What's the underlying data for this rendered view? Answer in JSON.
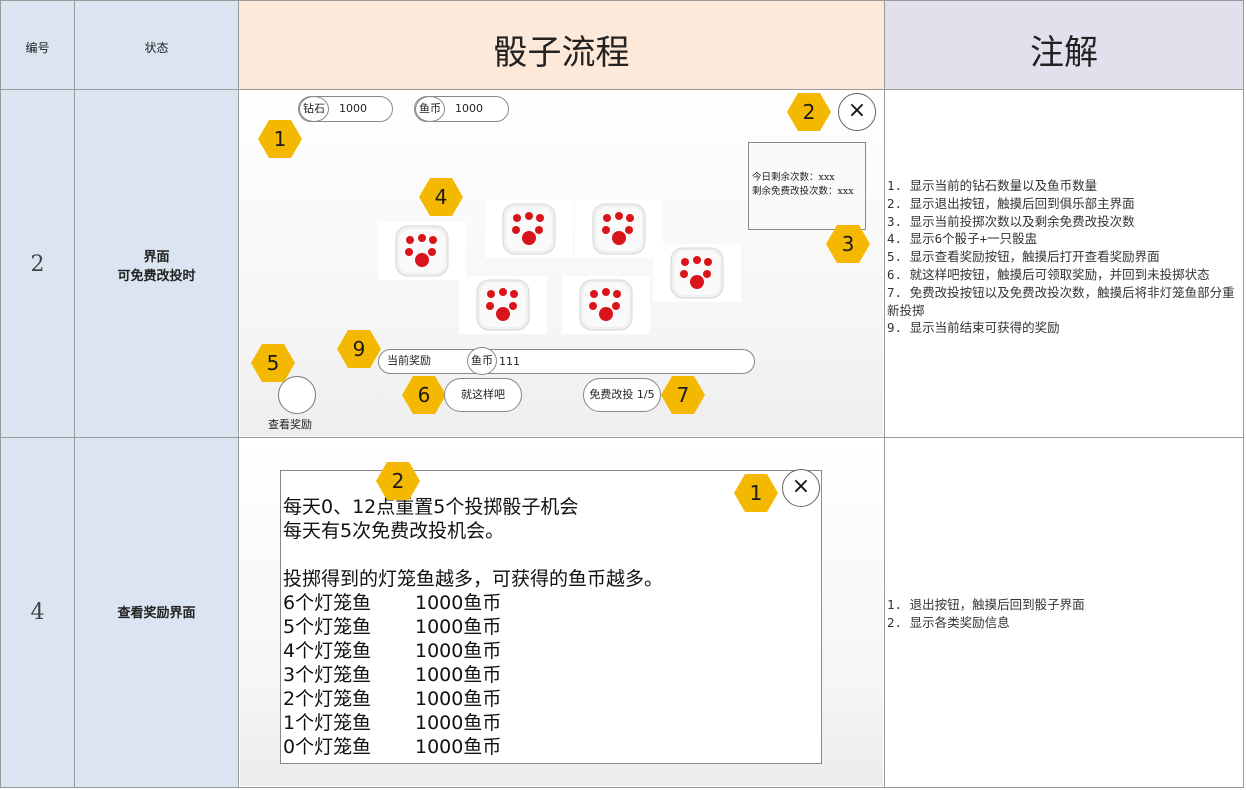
{
  "table": {
    "header": {
      "col_id": "编号",
      "col_state": "状态",
      "col_flow": "骰子流程",
      "col_notes": "注解"
    },
    "rows": [
      {
        "id": "2",
        "state_line1": "界面",
        "state_line2": "可免费改投时",
        "notes": [
          "1. 显示当前的钻石数量以及鱼币数量",
          "2. 显示退出按钮，触摸后回到俱乐部主界面",
          "3. 显示当前投掷次数以及剩余免费改投次数",
          "4. 显示6个骰子+一只骰盅",
          "5. 显示查看奖励按钮，触摸后打开查看奖励界面",
          "6. 就这样吧按钮，触摸后可领取奖励，并回到未投掷状态",
          "7. 免费改投按钮以及免费改投次数，触摸后将非灯笼鱼部分重新投掷",
          "9. 显示当前结束可获得的奖励"
        ]
      },
      {
        "id": "4",
        "state_line1": "查看奖励界面",
        "notes": [
          "1. 退出按钮，触摸后回到骰子界面",
          "2. 显示各类奖励信息"
        ]
      }
    ]
  },
  "mock_dice": {
    "diamond_label": "钻石",
    "diamond_value": "1000",
    "fishcoin_label": "鱼币",
    "fishcoin_value": "1000",
    "close_glyph": "×",
    "info_today_left": "今日剩余次数：xxx",
    "info_free_left": "剩余免费改投次数：xxx",
    "reward_label": "当前奖励",
    "reward_coin_label": "鱼币",
    "reward_value": "111",
    "accept_button": "就这样吧",
    "reroll_button": "免费改投 1/5",
    "view_reward_button": "查看奖励",
    "markers": [
      "1",
      "2",
      "3",
      "4",
      "5",
      "6",
      "7",
      "9"
    ],
    "dice_count": 6,
    "pip_color": "#d9141b"
  },
  "mock_reward": {
    "close_glyph": "×",
    "markers": [
      "1",
      "2"
    ],
    "line1": "每天0、12点重置5个投掷骰子机会",
    "line2": "每天有5次免费改投机会。",
    "line3": "投掷得到的灯笼鱼越多，可获得的鱼币越多。",
    "rewards": [
      {
        "fish": "6个灯笼鱼",
        "coins": "1000鱼币"
      },
      {
        "fish": "5个灯笼鱼",
        "coins": "1000鱼币"
      },
      {
        "fish": "4个灯笼鱼",
        "coins": "1000鱼币"
      },
      {
        "fish": "3个灯笼鱼",
        "coins": "1000鱼币"
      },
      {
        "fish": "2个灯笼鱼",
        "coins": "1000鱼币"
      },
      {
        "fish": "1个灯笼鱼",
        "coins": "1000鱼币"
      },
      {
        "fish": "0个灯笼鱼",
        "coins": "1000鱼币"
      }
    ]
  },
  "colors": {
    "header_blue": "#dbe5f1",
    "header_flow": "#fde9d9",
    "header_notes": "#e4dfec",
    "marker": "#f5b800"
  }
}
